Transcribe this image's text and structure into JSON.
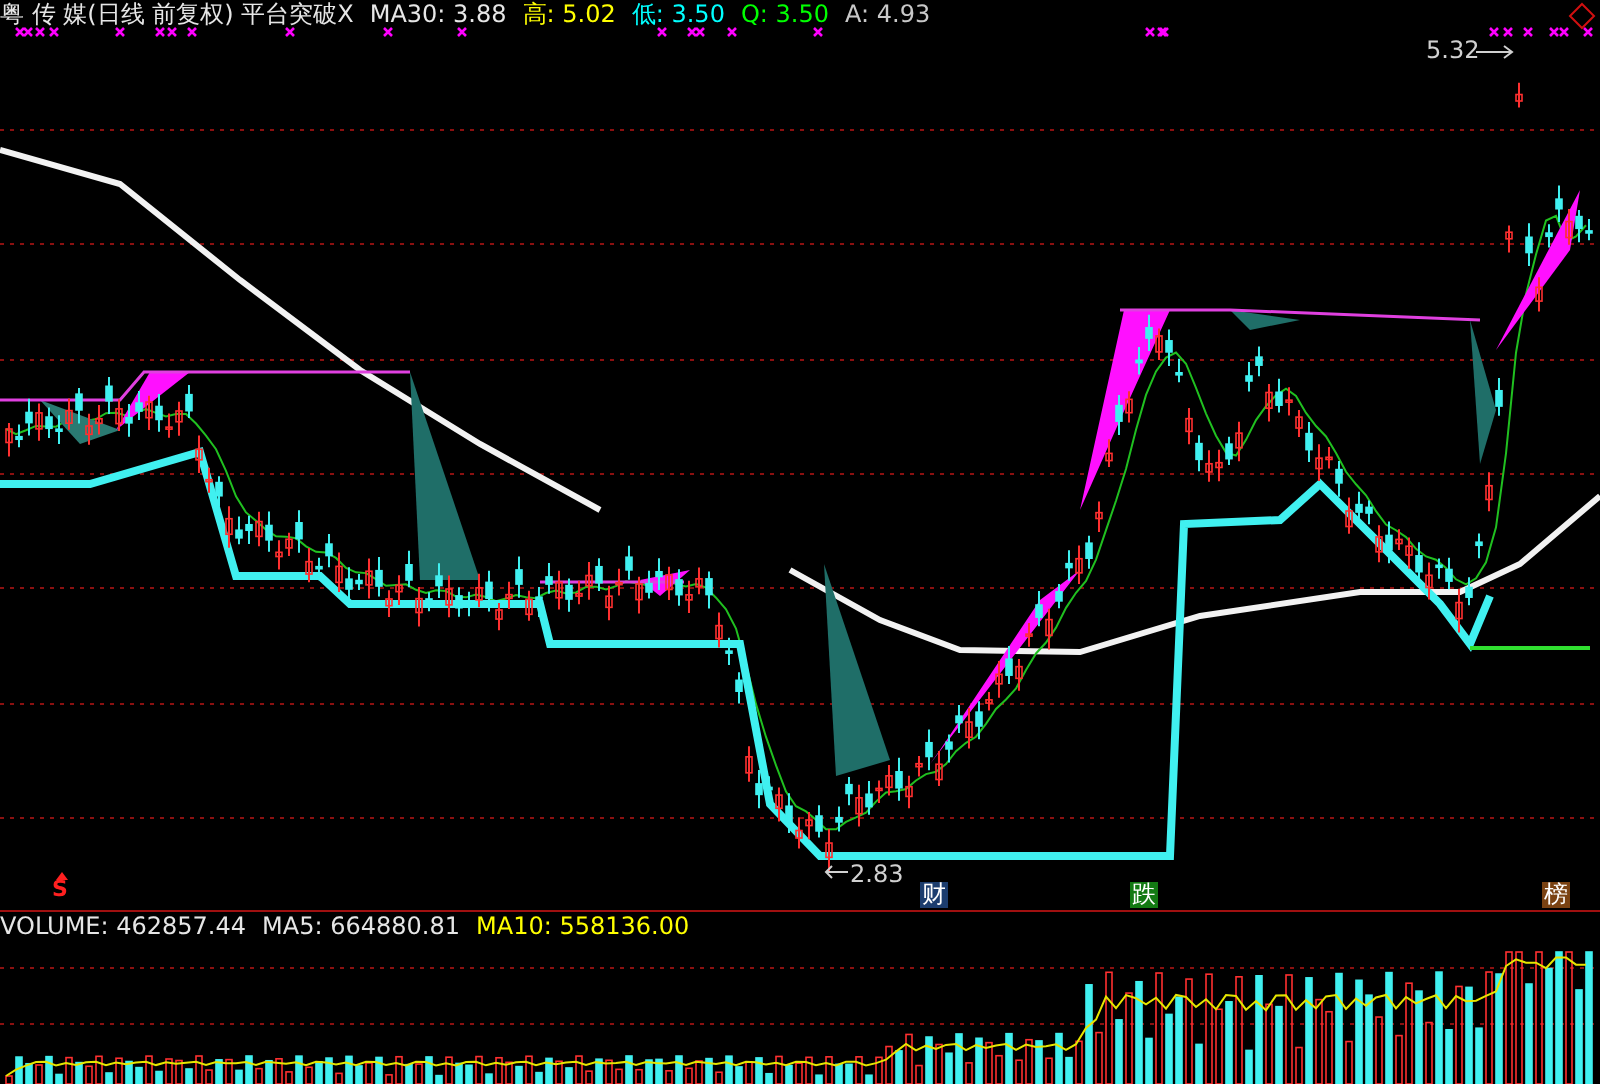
{
  "header": {
    "title": "粤 传 媒(日线 前复权) 平台突破X",
    "stats": [
      {
        "label": "MA30:",
        "value": "3.88",
        "color": "#e6e6e6"
      },
      {
        "label": "高:",
        "value": "5.02",
        "color": "#ffff00"
      },
      {
        "label": "低:",
        "value": "3.50",
        "color": "#00ffff"
      },
      {
        "label": "Q:",
        "value": "3.50",
        "color": "#00ff00"
      },
      {
        "label": "A:",
        "value": "4.93",
        "color": "#c8c8c8"
      }
    ]
  },
  "price_chart": {
    "high_label": "5.32",
    "low_label": "2.83",
    "signal": "S",
    "badges": [
      {
        "text": "财",
        "color": "#1c3d6e"
      },
      {
        "text": "跌",
        "color": "#137a13"
      },
      {
        "text": "榜",
        "color": "#7a4212"
      }
    ]
  },
  "volume_panel": {
    "stats": [
      {
        "label": "VOLUME:",
        "value": "462857.44",
        "color": "#e6e6e6"
      },
      {
        "label": "MA5:",
        "value": "664880.81",
        "color": "#e6e6e6"
      },
      {
        "label": "MA10:",
        "value": "558136.00",
        "color": "#ffff00"
      }
    ]
  }
}
